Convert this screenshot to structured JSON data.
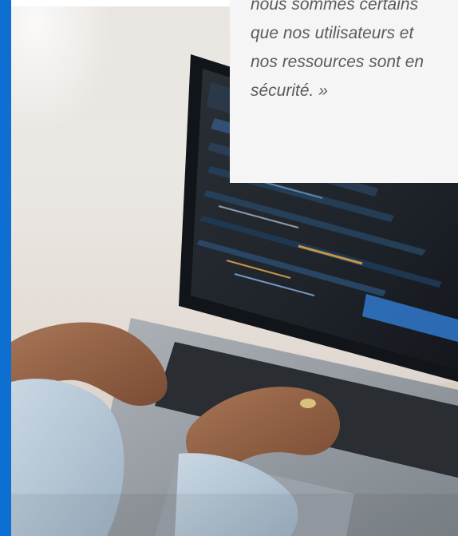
{
  "quote": {
    "text": "nous sommes certains\nque nos utilisateurs et\nnos ressources sont en\nsécurité. »"
  },
  "image": {
    "subject": "laptop-coding-photo"
  },
  "colors": {
    "accent": "#0d6fd1",
    "card_bg": "#f5f5f5",
    "quote_text": "#5b5b5b"
  }
}
